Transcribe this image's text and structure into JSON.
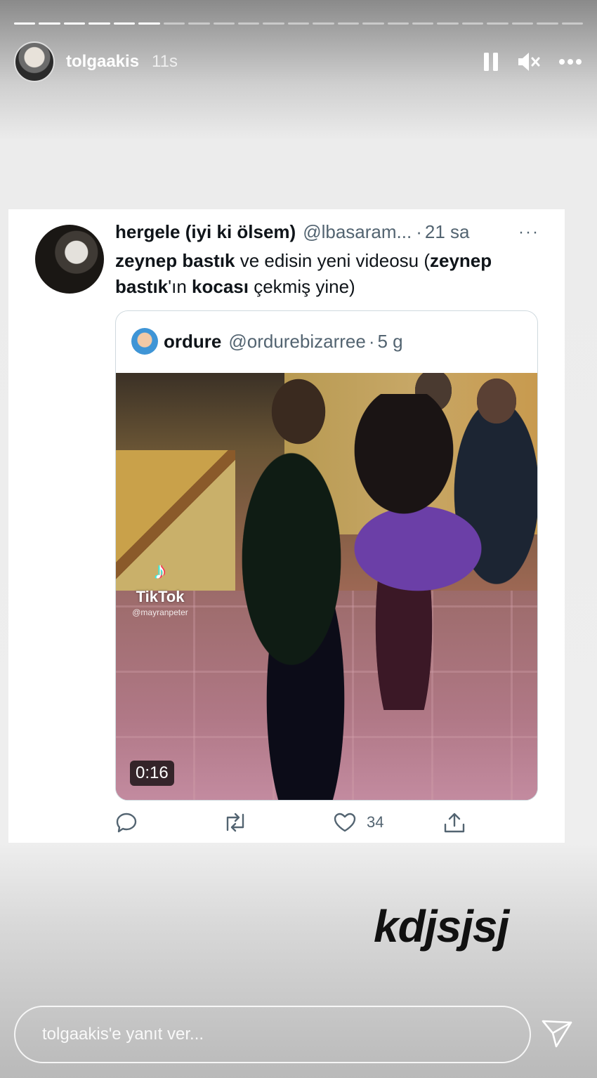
{
  "story": {
    "username": "tolgaakis",
    "time_ago": "11s",
    "segments_total": 23,
    "segments_done": 6,
    "sticker_text": "kdjsjsj",
    "reply_placeholder": "tolgaakis'e yanıt ver..."
  },
  "icons": {
    "pause": "pause-icon",
    "mute": "speaker-muted-icon",
    "more": "more-icon",
    "send": "send-icon"
  },
  "tweet": {
    "name": "hergele (iyi ki ölsem)",
    "handle": "@lbasaram...",
    "dot": "·",
    "time": "21 sa",
    "more": "···",
    "text": {
      "p1": "zeynep bastık",
      "p2": " ve edisin yeni videosu (",
      "p3": "zeynep bastık",
      "p4": "'ın ",
      "p5": "kocası",
      "p6": " çekmiş yine)"
    },
    "quote": {
      "name": "ordure",
      "handle": "@ordurebizarree",
      "dot": "·",
      "time": "5 g",
      "video": {
        "watermark_name": "TikTok",
        "watermark_user": "@mayranpeter",
        "duration": "0:16"
      }
    },
    "actions": {
      "likes": "34"
    }
  }
}
